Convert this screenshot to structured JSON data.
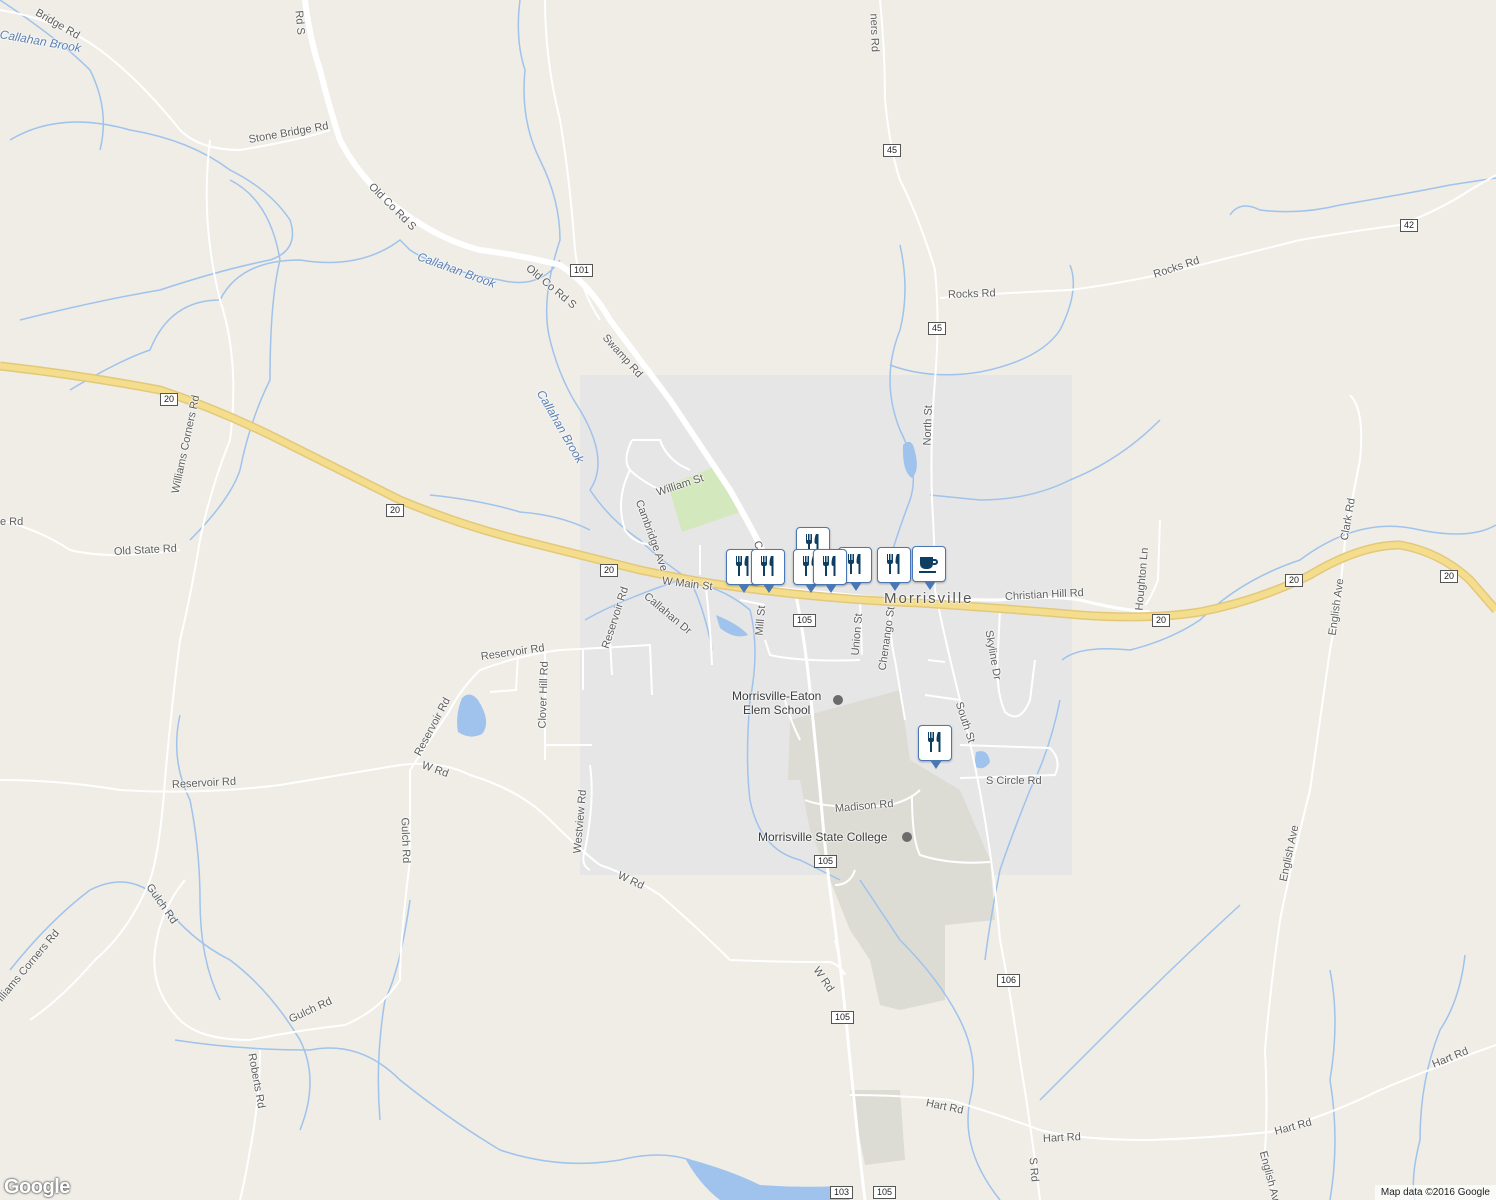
{
  "map": {
    "place_label": "Morrisville",
    "attribution": "Map data ©2016 Google",
    "logo_text": "Google",
    "colors": {
      "land": "#efede6",
      "highlight": "#e6e6e6",
      "highway": "#f4dd8d",
      "water": "#9fc3ec",
      "campus": "#dcdcd4",
      "park": "#d4e8bd",
      "marker_fill": "#0e3f63"
    },
    "roads": {
      "stone_bridge": "Stone Bridge Rd",
      "bridge_topleft": "Bridge Rd",
      "old_co_rd_s_top": "Rd S",
      "old_co_rd_s_1": "Old Co Rd S",
      "old_co_rd_s_2": "Old Co Rd S",
      "swamp_rd": "Swamp Rd",
      "williams_corners": "Williams Corners Rd",
      "williams_corners_sw": "illiams Corners Rd",
      "old_state": "Old State Rd",
      "state_rd_left": "e Rd",
      "william_st": "William St",
      "cambridge_ave": "Cambridge Ave",
      "w_main_st": "W Main St",
      "mill_st": "Mill St",
      "callahan_dr": "Callahan Dr",
      "reservoir_rd_1": "Reservoir Rd",
      "reservoir_rd_2": "Reservoir Rd",
      "reservoir_rd_3": "Reservoir Rd",
      "reservoir_rd_4": "Reservoir Rd",
      "clover_hill": "Clover Hill Rd",
      "gulch_rd_1": "Gulch Rd",
      "gulch_rd_2": "Gulch Rd",
      "gulch_rd_3": "Gulch Rd",
      "w_rd_1": "W Rd",
      "w_rd_2": "W Rd",
      "w_rd_3": "W Rd",
      "westview": "Westview Rd",
      "roberts": "Roberts Rd",
      "union_st": "Union St",
      "chenango_st": "Chenango St",
      "south_st": "South St",
      "north_st": "North St",
      "skyline": "Skyline Dr",
      "christian_hill": "Christian Hill Rd",
      "houghton": "Houghton Ln",
      "clark": "Clark Rd",
      "english_1": "English Ave",
      "english_2": "English Ave",
      "english_3": "English Ave",
      "rocks_rd_1": "Rocks Rd",
      "rocks_rd_2": "Rocks Rd",
      "s_circle": "S Circle Rd",
      "madison": "Madison Rd",
      "hart_rd_1": "Hart Rd",
      "hart_rd_2": "Hart Rd",
      "hart_rd_3": "Hart Rd",
      "hart_rd_4": "Hart Rd",
      "s_rd": "S Rd",
      "corners_top": "ners Rd",
      "ce_label": "Ce"
    },
    "water_labels": {
      "callahan_1": "Callahan Brook",
      "callahan_2": "Callahan Brook",
      "callahan_3": "Callahan Brook"
    },
    "pois": {
      "elem_school_line1": "Morrisville-Eaton",
      "elem_school_line2": "Elem School",
      "college": "Morrisville State College"
    },
    "shields": {
      "us20_a": "20",
      "us20_b": "20",
      "us20_c": "20",
      "us20_d": "20",
      "us20_e": "20",
      "us20_f": "20",
      "rt101": "101",
      "rt45_a": "45",
      "rt45_b": "45",
      "rt42": "42",
      "rt105_a": "105",
      "rt105_b": "105",
      "rt105_c": "105",
      "rt105_d": "105",
      "rt106": "106",
      "rt103": "103"
    },
    "markers": [
      {
        "type": "restaurant",
        "icon": "fork-knife-icon"
      },
      {
        "type": "restaurant",
        "icon": "fork-knife-icon"
      },
      {
        "type": "restaurant",
        "icon": "fork-knife-icon"
      },
      {
        "type": "restaurant",
        "icon": "fork-knife-icon"
      },
      {
        "type": "restaurant",
        "icon": "fork-knife-icon"
      },
      {
        "type": "restaurant",
        "icon": "fork-knife-icon"
      },
      {
        "type": "restaurant",
        "icon": "fork-knife-icon"
      },
      {
        "type": "cafe",
        "icon": "coffee-cup-icon"
      },
      {
        "type": "restaurant",
        "icon": "fork-knife-icon"
      }
    ]
  }
}
